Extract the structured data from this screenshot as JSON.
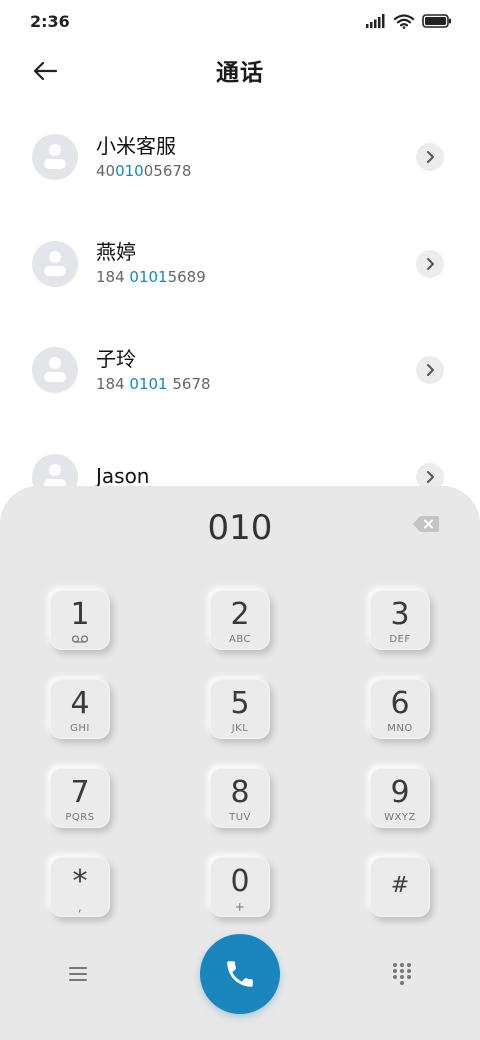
{
  "status_bar": {
    "time": "2:36",
    "icons": [
      "signal-icon",
      "wifi-icon",
      "battery-icon"
    ]
  },
  "header": {
    "title": "通话",
    "back_icon": "arrow-left-icon"
  },
  "contacts": [
    {
      "name": "小米客服",
      "number_pre": "40",
      "number_match": "010",
      "number_post": "05678"
    },
    {
      "name": "燕婷",
      "number_pre": "184 ",
      "number_match": "0101",
      "number_post": "5689"
    },
    {
      "name": "子玲",
      "number_pre": "184 ",
      "number_match": "0101",
      "number_post": " 5678"
    },
    {
      "name": "Jason",
      "number_pre": "",
      "number_match": "",
      "number_post": ""
    }
  ],
  "dialpad": {
    "display": "010",
    "keys": [
      {
        "digit": "1",
        "sub": ""
      },
      {
        "digit": "2",
        "sub": "ABC"
      },
      {
        "digit": "3",
        "sub": "DEF"
      },
      {
        "digit": "4",
        "sub": "GHI"
      },
      {
        "digit": "5",
        "sub": "JKL"
      },
      {
        "digit": "6",
        "sub": "MNO"
      },
      {
        "digit": "7",
        "sub": "PQRS"
      },
      {
        "digit": "8",
        "sub": "TUV"
      },
      {
        "digit": "9",
        "sub": "WXYZ"
      },
      {
        "digit": "*",
        "sub": ","
      },
      {
        "digit": "0",
        "sub": "+"
      },
      {
        "digit": "#",
        "sub": ""
      }
    ]
  },
  "colors": {
    "accent": "#1b86bd",
    "highlight": "#1a86b8",
    "dialpad_bg": "#e8e8e8",
    "avatar_bg": "#e3e5ea"
  }
}
